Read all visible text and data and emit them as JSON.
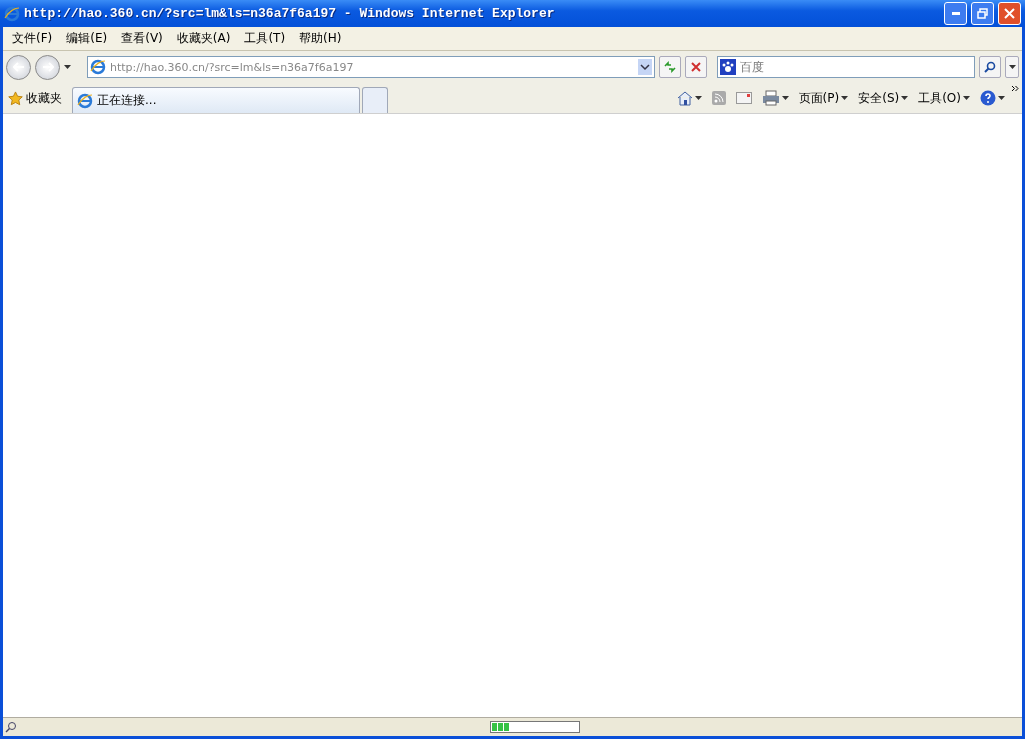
{
  "window": {
    "title": "http://hao.360.cn/?src=lm&ls=n36a7f6a197 - Windows Internet Explorer"
  },
  "menu": [
    "文件(F)",
    "编辑(E)",
    "查看(V)",
    "收藏夹(A)",
    "工具(T)",
    "帮助(H)"
  ],
  "address": {
    "value": "http://hao.360.cn/?src=lm&ls=n36a7f6a197"
  },
  "search": {
    "placeholder": "百度"
  },
  "favorites": {
    "label": "收藏夹"
  },
  "tabs": [
    {
      "label": "正在连接...",
      "selected": true,
      "kind": "page"
    },
    {
      "selected": false,
      "kind": "new"
    }
  ],
  "commands": [
    "页面(P)",
    "安全(S)",
    "工具(O)"
  ],
  "status_bar": {
    "progress": {
      "level": 0.2
    }
  }
}
